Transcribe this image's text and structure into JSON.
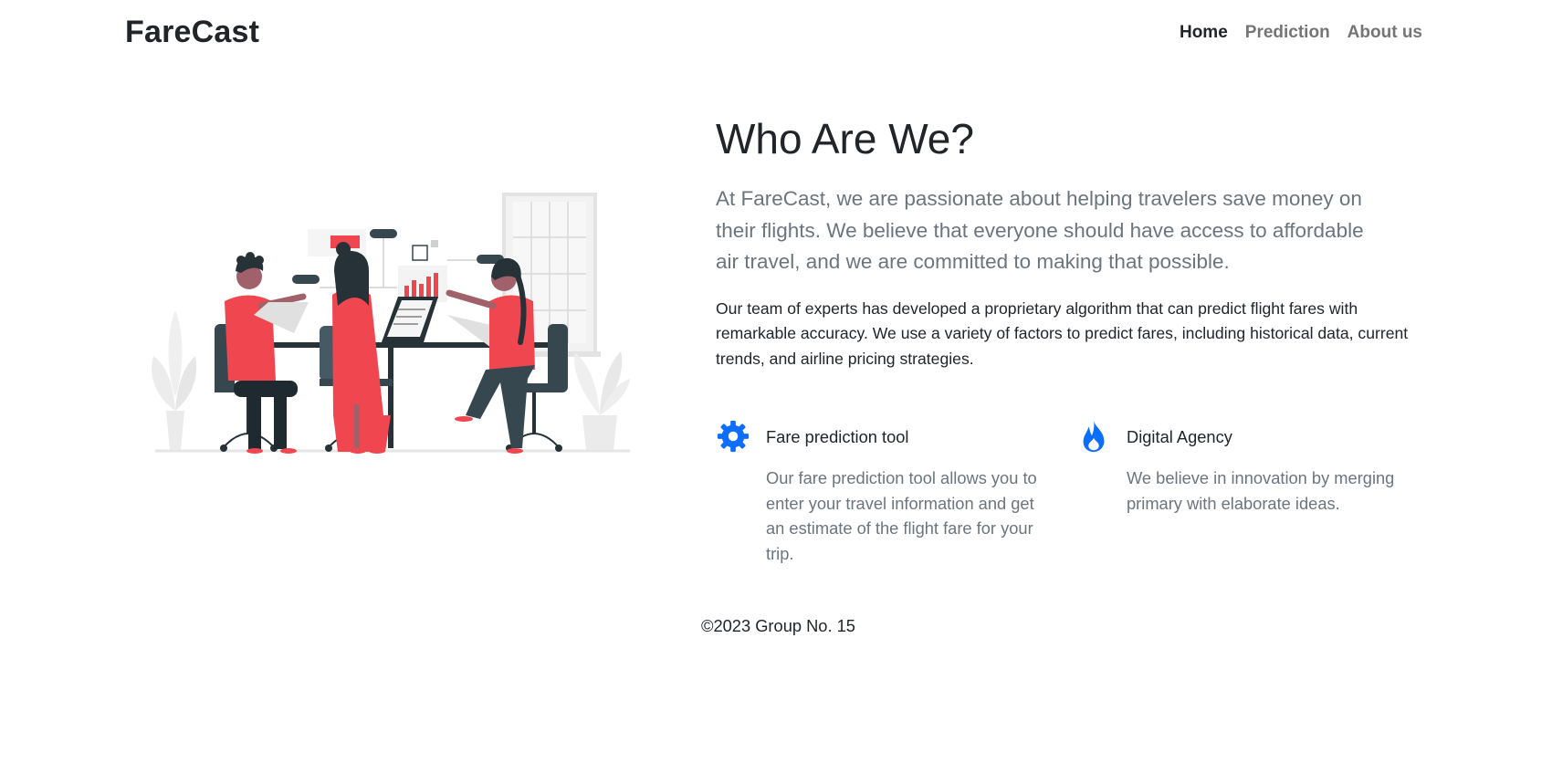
{
  "brand": "FareCast",
  "nav": {
    "items": [
      {
        "label": "Home",
        "active": true
      },
      {
        "label": "Prediction",
        "active": false
      },
      {
        "label": "About us",
        "active": false
      }
    ]
  },
  "about": {
    "heading": "Who Are We?",
    "lead": "At FareCast, we are passionate about helping travelers save money on their flights. We believe that everyone should have access to affordable air travel, and we are committed to making that possible.",
    "body": "Our team of experts has developed a proprietary algorithm that can predict flight fares with remarkable accuracy. We use a variety of factors to predict fares, including historical data, current trends, and airline pricing strategies."
  },
  "features": [
    {
      "icon": "gear-icon",
      "title": "Fare prediction tool",
      "description": "Our fare prediction tool allows you to enter your travel information and get an estimate of the flight fare for your trip."
    },
    {
      "icon": "fire-icon",
      "title": "Digital Agency",
      "description": "We believe in innovation by merging primary with elaborate ideas."
    }
  ],
  "footer": "©2023 Group No. 15",
  "colors": {
    "accent": "#0d6efd",
    "illustration_red": "#f0464f",
    "illustration_dark": "#37474f",
    "muted_text": "#6c757d"
  }
}
